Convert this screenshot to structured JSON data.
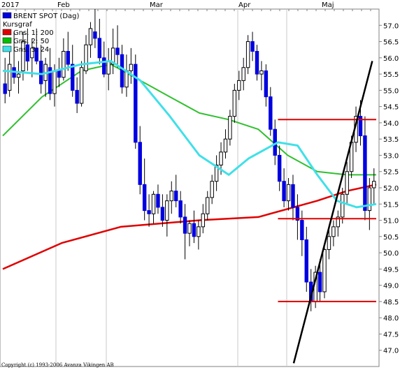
{
  "chart_data": {
    "type": "candlestick",
    "title": "BRENT SPOT (Dag)",
    "year_label": "2017",
    "months": [
      "Feb",
      "Mar",
      "Apr",
      "Maj"
    ],
    "ylim": [
      46.5,
      57.5
    ],
    "yticks": [
      "47.0",
      "47.5",
      "48.0",
      "48.5",
      "49.0",
      "49.5",
      "50.0",
      "50.5",
      "51.0",
      "51.5",
      "52.0",
      "52.5",
      "53.0",
      "53.5",
      "54.0",
      "54.5",
      "55.0",
      "55.5",
      "56.0",
      "56.5",
      "57.0"
    ],
    "legend": [
      {
        "label": "BRENT SPOT (Dag)",
        "color": "#0000e0"
      },
      {
        "label": "Kursgraf",
        "color": null
      },
      {
        "label": "Gns. 1: 200",
        "color": "#e00000"
      },
      {
        "label": "Gns. 2: 50",
        "color": "#00c000"
      },
      {
        "label": "Gns. 3: 24",
        "color": "#40e0e8"
      }
    ],
    "colors": {
      "candle": "#0000e0",
      "ma200": "#e00000",
      "ma50": "#30c030",
      "ma24": "#40e0e8",
      "support": "#e00000",
      "trend": "#000000"
    },
    "candles": [
      [
        55.2,
        56.0,
        54.6,
        54.9
      ],
      [
        55.0,
        56.3,
        54.8,
        55.8
      ],
      [
        55.7,
        56.8,
        55.2,
        55.4
      ],
      [
        55.4,
        55.9,
        54.9,
        55.5
      ],
      [
        55.6,
        56.8,
        55.3,
        56.5
      ],
      [
        56.4,
        56.9,
        55.6,
        55.9
      ],
      [
        56.0,
        56.6,
        55.4,
        56.3
      ],
      [
        56.3,
        56.9,
        55.8,
        55.9
      ],
      [
        55.9,
        56.4,
        54.9,
        55.2
      ],
      [
        55.3,
        56.0,
        54.8,
        55.8
      ],
      [
        55.7,
        56.3,
        54.7,
        54.9
      ],
      [
        54.9,
        55.8,
        54.5,
        55.6
      ],
      [
        55.6,
        56.0,
        55.1,
        55.4
      ],
      [
        55.4,
        56.6,
        55.3,
        56.2
      ],
      [
        56.2,
        56.8,
        55.6,
        55.8
      ],
      [
        55.8,
        56.4,
        54.8,
        55.0
      ],
      [
        55.0,
        55.4,
        54.3,
        54.6
      ],
      [
        54.6,
        55.9,
        54.5,
        55.7
      ],
      [
        55.6,
        56.7,
        55.5,
        56.4
      ],
      [
        56.4,
        57.1,
        56.0,
        56.9
      ],
      [
        56.8,
        57.5,
        56.3,
        56.6
      ],
      [
        56.6,
        57.2,
        55.8,
        56.0
      ],
      [
        56.0,
        56.5,
        55.4,
        55.5
      ],
      [
        55.5,
        56.3,
        55.0,
        55.9
      ],
      [
        55.8,
        56.9,
        55.5,
        56.3
      ],
      [
        56.3,
        57.0,
        55.7,
        56.1
      ],
      [
        56.1,
        56.4,
        54.9,
        55.1
      ],
      [
        55.1,
        56.1,
        54.8,
        55.6
      ],
      [
        55.6,
        56.3,
        55.2,
        55.8
      ],
      [
        55.8,
        56.1,
        53.2,
        53.4
      ],
      [
        53.4,
        53.9,
        51.8,
        52.1
      ],
      [
        52.1,
        52.9,
        51.0,
        51.3
      ],
      [
        51.3,
        51.8,
        50.8,
        51.2
      ],
      [
        51.2,
        51.9,
        50.9,
        51.8
      ],
      [
        51.8,
        52.1,
        51.2,
        51.4
      ],
      [
        51.4,
        51.8,
        50.8,
        51.0
      ],
      [
        51.0,
        51.8,
        50.5,
        51.6
      ],
      [
        51.6,
        52.2,
        51.2,
        51.9
      ],
      [
        51.9,
        52.4,
        51.4,
        51.6
      ],
      [
        51.6,
        51.9,
        50.9,
        51.1
      ],
      [
        51.1,
        51.5,
        49.8,
        50.6
      ],
      [
        50.6,
        51.0,
        50.2,
        50.9
      ],
      [
        50.9,
        51.3,
        50.3,
        50.5
      ],
      [
        50.5,
        51.0,
        50.1,
        50.8
      ],
      [
        50.8,
        51.5,
        50.6,
        51.2
      ],
      [
        51.2,
        51.9,
        51.0,
        51.7
      ],
      [
        51.7,
        52.4,
        51.5,
        52.2
      ],
      [
        52.2,
        53.0,
        51.9,
        52.7
      ],
      [
        52.7,
        53.4,
        52.4,
        53.1
      ],
      [
        53.1,
        53.8,
        52.9,
        53.5
      ],
      [
        53.5,
        54.4,
        53.3,
        54.2
      ],
      [
        54.2,
        55.2,
        54.0,
        55.0
      ],
      [
        55.0,
        55.6,
        54.7,
        55.3
      ],
      [
        55.3,
        56.0,
        55.0,
        55.7
      ],
      [
        55.7,
        56.7,
        55.5,
        56.5
      ],
      [
        56.5,
        56.8,
        55.9,
        56.2
      ],
      [
        56.2,
        56.4,
        55.3,
        55.5
      ],
      [
        55.5,
        55.9,
        55.0,
        55.6
      ],
      [
        55.6,
        55.8,
        54.5,
        54.8
      ],
      [
        54.8,
        55.1,
        53.6,
        53.8
      ],
      [
        53.8,
        54.1,
        52.7,
        53.0
      ],
      [
        53.0,
        53.3,
        51.9,
        52.2
      ],
      [
        52.2,
        52.6,
        51.4,
        51.6
      ],
      [
        51.6,
        52.3,
        51.3,
        52.1
      ],
      [
        52.1,
        52.4,
        51.0,
        51.4
      ],
      [
        51.4,
        51.8,
        50.4,
        51.0
      ],
      [
        51.0,
        51.3,
        49.9,
        50.4
      ],
      [
        50.4,
        50.8,
        48.8,
        49.1
      ],
      [
        49.1,
        49.5,
        48.2,
        48.5
      ],
      [
        48.5,
        49.6,
        48.3,
        49.4
      ],
      [
        49.4,
        49.8,
        48.5,
        48.8
      ],
      [
        48.8,
        50.3,
        48.6,
        50.1
      ],
      [
        50.1,
        50.8,
        49.8,
        50.5
      ],
      [
        50.5,
        51.0,
        50.2,
        50.8
      ],
      [
        50.8,
        51.3,
        50.5,
        51.1
      ],
      [
        51.1,
        52.0,
        50.9,
        51.8
      ],
      [
        51.8,
        52.8,
        51.5,
        52.5
      ],
      [
        52.5,
        53.6,
        52.3,
        53.4
      ],
      [
        53.4,
        54.5,
        53.1,
        54.2
      ],
      [
        54.2,
        54.7,
        53.3,
        53.6
      ],
      [
        53.6,
        54.2,
        51.0,
        51.3
      ],
      [
        51.3,
        52.3,
        50.7,
        52.0
      ],
      [
        52.0,
        52.6,
        51.5,
        52.2
      ]
    ],
    "series_ma200": [
      [
        0,
        49.5
      ],
      [
        30,
        50.3
      ],
      [
        60,
        50.8
      ],
      [
        100,
        51.0
      ],
      [
        130,
        51.1
      ],
      [
        160,
        51.6
      ],
      [
        175,
        51.9
      ],
      [
        190,
        52.1
      ]
    ],
    "series_ma50": [
      [
        0,
        53.6
      ],
      [
        20,
        54.8
      ],
      [
        40,
        55.6
      ],
      [
        55,
        55.8
      ],
      [
        70,
        55.3
      ],
      [
        85,
        54.8
      ],
      [
        100,
        54.3
      ],
      [
        115,
        54.1
      ],
      [
        130,
        53.8
      ],
      [
        145,
        53.0
      ],
      [
        160,
        52.5
      ],
      [
        175,
        52.4
      ],
      [
        190,
        52.4
      ]
    ],
    "series_ma24": [
      [
        0,
        55.6
      ],
      [
        20,
        55.5
      ],
      [
        40,
        55.8
      ],
      [
        55,
        55.9
      ],
      [
        70,
        55.3
      ],
      [
        85,
        54.2
      ],
      [
        100,
        53.0
      ],
      [
        115,
        52.4
      ],
      [
        125,
        52.9
      ],
      [
        140,
        53.4
      ],
      [
        150,
        53.3
      ],
      [
        160,
        52.4
      ],
      [
        170,
        51.6
      ],
      [
        180,
        51.4
      ],
      [
        190,
        51.5
      ]
    ],
    "support_lines": [
      {
        "y": 54.1,
        "x_from": 140,
        "x_to": 190
      },
      {
        "y": 51.05,
        "x_from": 140,
        "x_to": 190
      },
      {
        "y": 48.5,
        "x_from": 140,
        "x_to": 190
      }
    ],
    "trend_line": {
      "from": [
        148,
        46.6
      ],
      "to": [
        188,
        55.9
      ]
    },
    "copyright": "Copyright (c) 1993-2006 Avanza Vikingen AB"
  }
}
